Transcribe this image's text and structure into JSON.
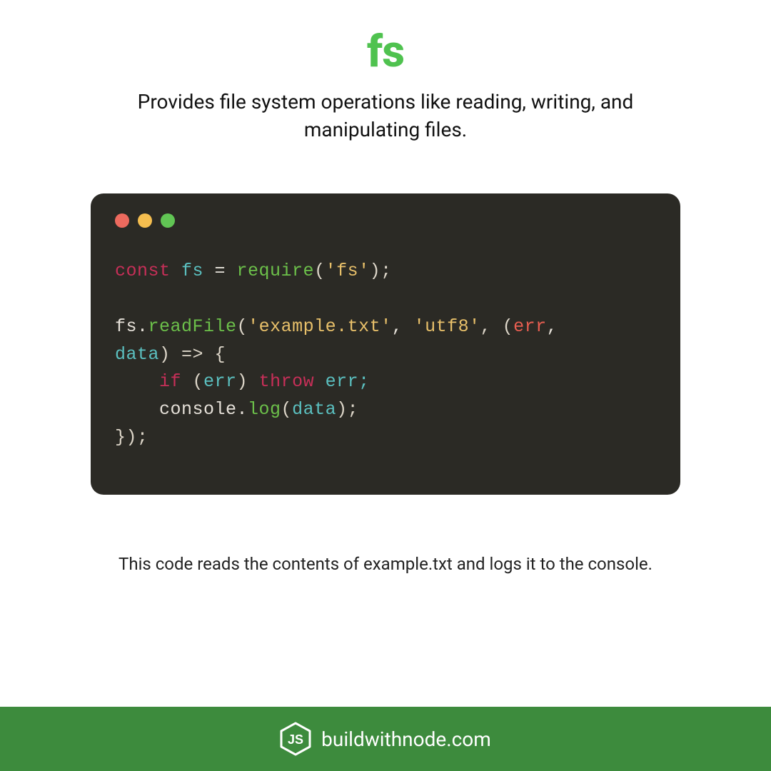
{
  "title": "fs",
  "subtitle": "Provides file system operations like reading, writing, and manipulating files.",
  "caption": "This code reads the contents of example.txt and logs it to the console.",
  "footer": {
    "site": "buildwithnode.com"
  },
  "colors": {
    "green_title": "#4fc24f",
    "code_bg": "#2b2a25",
    "footer_bg": "#3d8b3d"
  },
  "code_tokens": [
    [
      {
        "t": "const ",
        "c": "c-kw"
      },
      {
        "t": "fs",
        "c": "c-var"
      },
      {
        "t": " = "
      },
      {
        "t": "require",
        "c": "c-fn"
      },
      {
        "t": "(",
        "c": "c-paren"
      },
      {
        "t": "'fs'",
        "c": "c-str"
      },
      {
        "t": ");",
        "c": "c-paren"
      }
    ],
    [],
    [
      {
        "t": "fs."
      },
      {
        "t": "readFile",
        "c": "c-fn"
      },
      {
        "t": "(",
        "c": "c-paren"
      },
      {
        "t": "'example.txt'",
        "c": "c-str"
      },
      {
        "t": ", "
      },
      {
        "t": "'utf8'",
        "c": "c-str"
      },
      {
        "t": ", (",
        "c": "c-paren"
      },
      {
        "t": "err",
        "c": "c-err"
      },
      {
        "t": ", "
      }
    ],
    [
      {
        "t": "data",
        "c": "c-var"
      },
      {
        "t": ") => {",
        "c": "c-paren"
      }
    ],
    [
      {
        "t": "    "
      },
      {
        "t": "if",
        "c": "c-kw"
      },
      {
        "t": " (",
        "c": "c-paren"
      },
      {
        "t": "err",
        "c": "c-var"
      },
      {
        "t": ") ",
        "c": "c-paren"
      },
      {
        "t": "throw",
        "c": "c-kw"
      },
      {
        "t": " err;",
        "c": "c-var"
      }
    ],
    [
      {
        "t": "    console."
      },
      {
        "t": "log",
        "c": "c-fn"
      },
      {
        "t": "(",
        "c": "c-paren"
      },
      {
        "t": "data",
        "c": "c-var"
      },
      {
        "t": ");",
        "c": "c-paren"
      }
    ],
    [
      {
        "t": "});",
        "c": "c-paren"
      }
    ]
  ]
}
